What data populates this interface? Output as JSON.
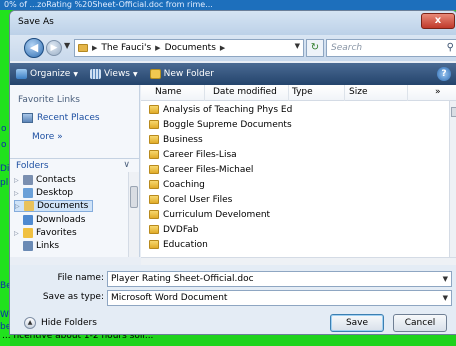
{
  "background": {
    "top_text": "0% of ...zoRating %20Sheet-Official.doc from rime...",
    "left_marks": [
      "o",
      "o",
      "Di",
      "pl",
      "Be",
      "We",
      "be"
    ],
    "bottom_text": "... ncentive about 1-2 hours soli..."
  },
  "dialog": {
    "title": "Save As",
    "close_label": "x"
  },
  "address": {
    "breadcrumbs": [
      "The Fauci's",
      "Documents"
    ],
    "search_placeholder": "Search"
  },
  "toolbar": {
    "organize": "Organize",
    "views": "Views",
    "new_folder": "New Folder",
    "help": "?"
  },
  "nav": {
    "favorite_links_heading": "Favorite Links",
    "favorites": [
      "Recent Places"
    ],
    "more": "More »",
    "folders_label": "Folders",
    "tree": [
      {
        "label": "Contacts",
        "icon": "contacts-icon",
        "color": "#7a8fb0",
        "has_arrow": true
      },
      {
        "label": "Desktop",
        "icon": "desktop-icon",
        "color": "#6aa0d8",
        "has_arrow": true
      },
      {
        "label": "Documents",
        "icon": "documents-icon",
        "color": "#e9c25a",
        "has_arrow": true,
        "selected": true
      },
      {
        "label": "Downloads",
        "icon": "downloads-icon",
        "color": "#4f8ad0",
        "has_arrow": false
      },
      {
        "label": "Favorites",
        "icon": "favorites-icon",
        "color": "#f0c040",
        "has_arrow": true
      },
      {
        "label": "Links",
        "icon": "links-icon",
        "color": "#6a8ab4",
        "has_arrow": false
      }
    ]
  },
  "files": {
    "columns": [
      "Name",
      "Date modified",
      "Type",
      "Size"
    ],
    "more_columns": "»",
    "rows": [
      "Analysis of Teaching Phys Ed",
      "Boggle Supreme Documents",
      "Business",
      "Career Files-Lisa",
      "Career Files-Michael",
      "Coaching",
      "Corel User Files",
      "Curriculum Develoment",
      "DVDFab",
      "Education"
    ]
  },
  "form": {
    "file_name_label": "File name:",
    "file_name_value": "Player Rating Sheet-Official.doc",
    "save_type_label": "Save as type:",
    "save_type_value": "Microsoft Word Document",
    "hide_folders": "Hide Folders",
    "save": "Save",
    "cancel": "Cancel"
  }
}
